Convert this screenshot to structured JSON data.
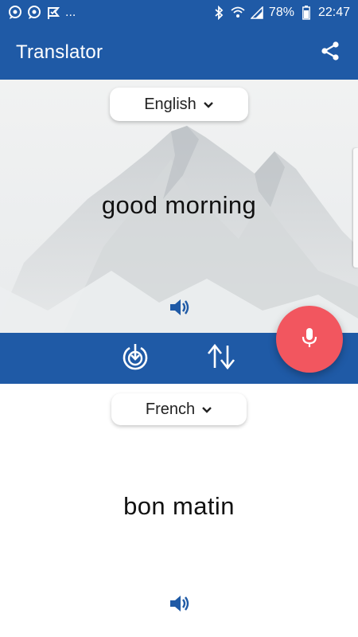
{
  "status_bar": {
    "left_icons": [
      "chat-bubble-icon",
      "chat-bubble-icon",
      "check-flag-icon"
    ],
    "more": "...",
    "right_icons": [
      "bluetooth-icon",
      "wifi-icon",
      "signal-icon",
      "battery-icon"
    ],
    "battery": "78%",
    "time": "22:47"
  },
  "app_bar": {
    "title": "Translator",
    "share_icon": "share-icon"
  },
  "source": {
    "language": "English",
    "text": "good morning",
    "speaker_icon": "speaker-icon"
  },
  "actions": {
    "download_icon": "download-icon",
    "swap_icon": "swap-icon",
    "mic_icon": "microphone-icon"
  },
  "target": {
    "language": "French",
    "text": "bon matin",
    "speaker_icon": "speaker-icon"
  },
  "colors": {
    "primary": "#1f5aa6",
    "fab": "#f2565f"
  }
}
